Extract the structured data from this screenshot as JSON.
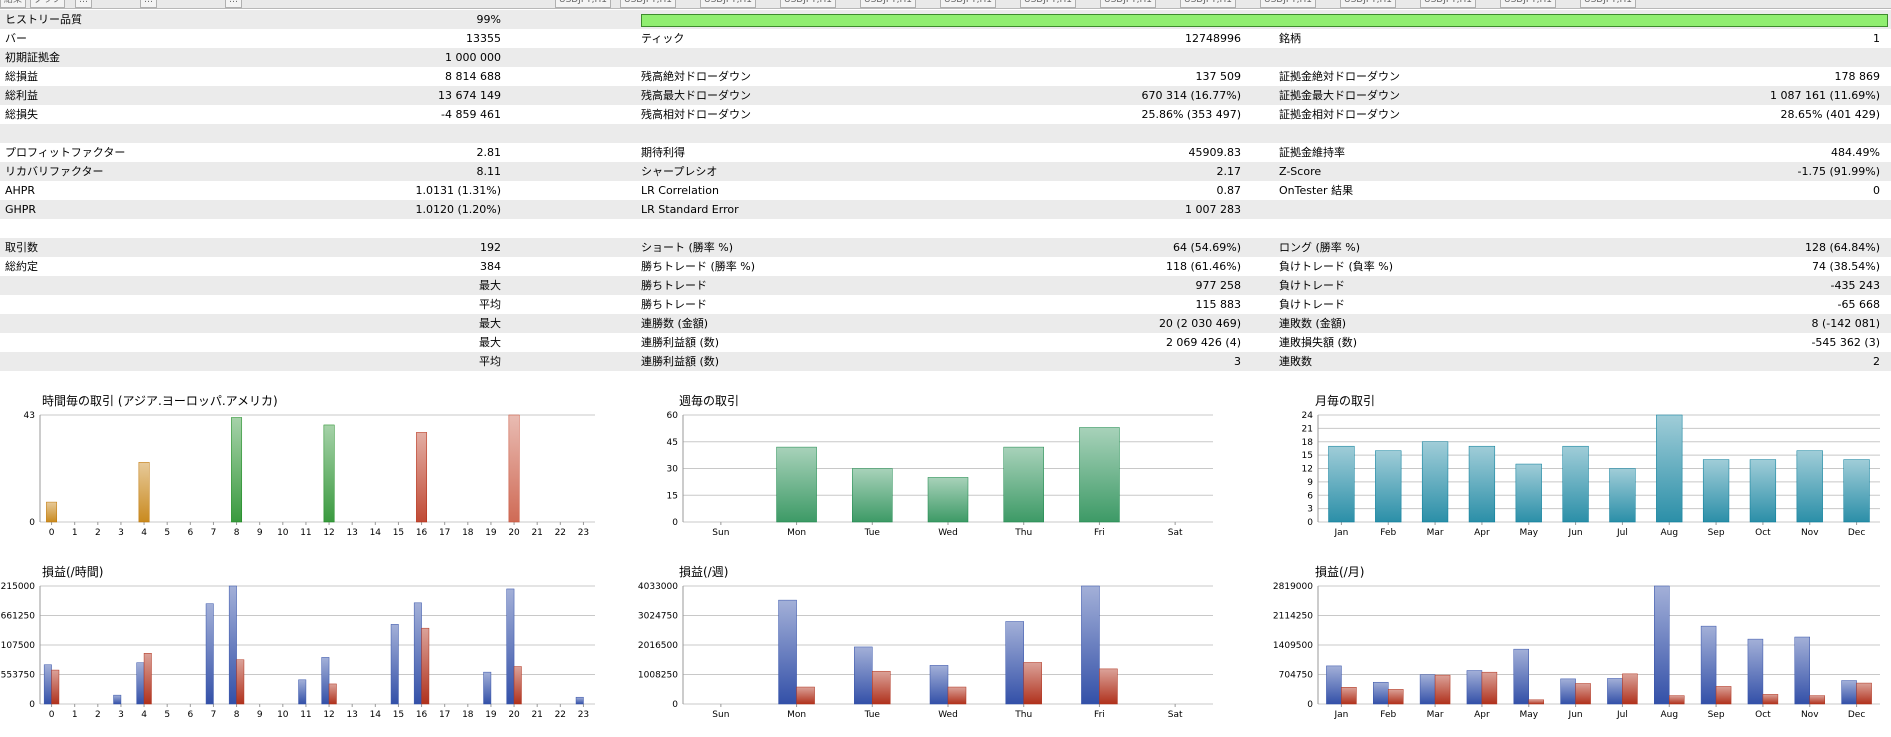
{
  "top_tabs": [
    "結果",
    "グラフ",
    "…",
    "…",
    "…",
    "USDJPY,H1",
    "USDJPY,H1",
    "USDJPY,H1",
    "USDJPY,H1",
    "USDJPY,H1",
    "USDJPY,H1",
    "USDJPY,H1",
    "USDJPY,H1",
    "USDJPY,H1",
    "USDJPY,H1",
    "USDJPY,H1",
    "USDJPY,H1",
    "USDJPY,H1",
    "USDJPY,H1"
  ],
  "stats": {
    "history_quality": {
      "label": "ヒストリー品質",
      "value": "99%",
      "fill_fraction": 0.99
    },
    "rows": [
      {
        "l1": "バー",
        "v1": "13355",
        "l2": "ティック",
        "v2": "12748996",
        "l3": "銘柄",
        "v3": "1"
      },
      {
        "l1": "初期証拠金",
        "v1": "1 000 000",
        "l2": "",
        "v2": "",
        "l3": "",
        "v3": ""
      },
      {
        "l1": "総損益",
        "v1": "8 814 688",
        "l2": "残高絶対ドローダウン",
        "v2": "137 509",
        "l3": "証拠金絶対ドローダウン",
        "v3": "178 869"
      },
      {
        "l1": "総利益",
        "v1": "13 674 149",
        "l2": "残高最大ドローダウン",
        "v2": "670 314 (16.77%)",
        "l3": "証拠金最大ドローダウン",
        "v3": "1 087 161 (11.69%)"
      },
      {
        "l1": "総損失",
        "v1": "-4 859 461",
        "l2": "残高相対ドローダウン",
        "v2": "25.86% (353 497)",
        "l3": "証拠金相対ドローダウン",
        "v3": "28.65% (401 429)"
      },
      {
        "l1": "",
        "v1": "",
        "l2": "",
        "v2": "",
        "l3": "",
        "v3": ""
      },
      {
        "l1": "プロフィットファクター",
        "v1": "2.81",
        "l2": "期待利得",
        "v2": "45909.83",
        "l3": "証拠金維持率",
        "v3": "484.49%"
      },
      {
        "l1": "リカバリファクター",
        "v1": "8.11",
        "l2": "シャープレシオ",
        "v2": "2.17",
        "l3": "Z-Score",
        "v3": "-1.75 (91.99%)"
      },
      {
        "l1": "AHPR",
        "v1": "1.0131 (1.31%)",
        "l2": "LR Correlation",
        "v2": "0.87",
        "l3": "OnTester 結果",
        "v3": "0"
      },
      {
        "l1": "GHPR",
        "v1": "1.0120 (1.20%)",
        "l2": "LR Standard Error",
        "v2": "1 007 283",
        "l3": "",
        "v3": ""
      },
      {
        "l1": "",
        "v1": "",
        "l2": "",
        "v2": "",
        "l3": "",
        "v3": ""
      },
      {
        "l1": "取引数",
        "v1": "192",
        "l2": "ショート (勝率 %)",
        "v2": "64 (54.69%)",
        "l3": "ロング (勝率 %)",
        "v3": "128 (64.84%)"
      },
      {
        "l1": "総約定",
        "v1": "384",
        "l2": "勝ちトレード (勝率 %)",
        "v2": "118 (61.46%)",
        "l3": "負けトレード (負率 %)",
        "v3": "74 (38.54%)"
      },
      {
        "l1": "",
        "v1": "最大",
        "l2": "勝ちトレード",
        "v2": "977 258",
        "l3": "負けトレード",
        "v3": "-435 243"
      },
      {
        "l1": "",
        "v1": "平均",
        "l2": "勝ちトレード",
        "v2": "115 883",
        "l3": "負けトレード",
        "v3": "-65 668"
      },
      {
        "l1": "",
        "v1": "最大",
        "l2": "連勝数 (金額)",
        "v2": "20 (2 030 469)",
        "l3": "連敗数 (金額)",
        "v3": "8 (-142 081)"
      },
      {
        "l1": "",
        "v1": "最大",
        "l2": "連勝利益額 (数)",
        "v2": "2 069 426 (4)",
        "l3": "連敗損失額 (数)",
        "v3": "-545 362 (3)"
      },
      {
        "l1": "",
        "v1": "平均",
        "l2": "連勝利益額 (数)",
        "v2": "3",
        "l3": "連敗数",
        "v3": "2"
      }
    ]
  },
  "chart_data": [
    {
      "id": "hourly-trades",
      "type": "bar",
      "title": "時間毎の取引 (アジア.ヨーロッパ.アメリカ)",
      "categories": [
        "0",
        "1",
        "2",
        "3",
        "4",
        "5",
        "6",
        "7",
        "8",
        "9",
        "10",
        "11",
        "12",
        "13",
        "14",
        "15",
        "16",
        "17",
        "18",
        "19",
        "20",
        "21",
        "22",
        "23"
      ],
      "values": [
        8,
        0,
        0,
        0,
        24,
        0,
        0,
        0,
        42,
        0,
        0,
        0,
        39,
        0,
        0,
        0,
        36,
        0,
        0,
        0,
        43,
        0,
        0,
        0
      ],
      "bar_colors": [
        "#c98a1f",
        "#c98a1f",
        "#c98a1f",
        "#c98a1f",
        "#c98a1f",
        "#c98a1f",
        "#c98a1f",
        "#c98a1f",
        "#3a9a3f",
        "#3a9a3f",
        "#3a9a3f",
        "#3a9a3f",
        "#3a9a3f",
        "#3a9a3f",
        "#3a9a3f",
        "#3a9a3f",
        "#c04a35",
        "#c04a35",
        "#c04a35",
        "#c04a35",
        "#cf6a55",
        "#cf6a55",
        "#cf6a55",
        "#cf6a55"
      ],
      "yticks": [
        "43",
        "0"
      ],
      "ylim": [
        0,
        43
      ],
      "grid": true
    },
    {
      "id": "weekly-trades",
      "type": "bar",
      "title": "週毎の取引",
      "categories": [
        "Sun",
        "Mon",
        "Tue",
        "Wed",
        "Thu",
        "Fri",
        "Sat"
      ],
      "values": [
        0,
        42,
        30,
        25,
        42,
        53,
        0
      ],
      "bar_color": "#3d9a66",
      "yticks": [
        "60",
        "45",
        "30",
        "15",
        "0"
      ],
      "ylim": [
        0,
        60
      ],
      "grid": true
    },
    {
      "id": "monthly-trades",
      "type": "bar",
      "title": "月毎の取引",
      "categories": [
        "Jan",
        "Feb",
        "Mar",
        "Apr",
        "May",
        "Jun",
        "Jul",
        "Aug",
        "Sep",
        "Oct",
        "Nov",
        "Dec"
      ],
      "values": [
        17,
        16,
        18,
        17,
        13,
        17,
        12,
        24,
        14,
        14,
        16,
        14
      ],
      "bar_color": "#2b8fa8",
      "yticks": [
        "24",
        "21",
        "18",
        "15",
        "12",
        "9",
        "6",
        "3",
        "0"
      ],
      "ylim": [
        0,
        24
      ],
      "grid": true
    },
    {
      "id": "hourly-pnl",
      "type": "bar",
      "title": "損益(/時間)",
      "categories": [
        "0",
        "1",
        "2",
        "3",
        "4",
        "5",
        "6",
        "7",
        "8",
        "9",
        "10",
        "11",
        "12",
        "13",
        "14",
        "15",
        "16",
        "17",
        "18",
        "19",
        "20",
        "21",
        "22",
        "23"
      ],
      "series": [
        {
          "values": [
            1330000,
            0,
            0,
            300000,
            1400000,
            0,
            0,
            3400000,
            4000000,
            0,
            0,
            820000,
            1580000,
            0,
            0,
            2700000,
            3430000,
            0,
            0,
            1080000,
            3900000,
            0,
            0,
            230000
          ],
          "color": "#3350a8"
        },
        {
          "values": [
            1150000,
            0,
            0,
            0,
            1720000,
            0,
            0,
            0,
            1500000,
            0,
            0,
            0,
            680000,
            0,
            0,
            0,
            2570000,
            0,
            0,
            0,
            1270000,
            0,
            0,
            0
          ],
          "color": "#b0311c"
        }
      ],
      "yticks": [
        "215000",
        "661250",
        "107500",
        "553750",
        "0"
      ],
      "ylim": [
        0,
        4000000
      ],
      "grid": true
    },
    {
      "id": "weekly-pnl",
      "type": "bar",
      "title": "損益(/週)",
      "categories": [
        "Sun",
        "Mon",
        "Tue",
        "Wed",
        "Thu",
        "Fri",
        "Sat"
      ],
      "series": [
        {
          "values": [
            0,
            3550000,
            1950000,
            1320000,
            2820000,
            4033000,
            0
          ],
          "color": "#3350a8"
        },
        {
          "values": [
            0,
            580000,
            1120000,
            580000,
            1420000,
            1200000,
            0
          ],
          "color": "#b0311c"
        }
      ],
      "yticks": [
        "4033000",
        "3024750",
        "2016500",
        "1008250",
        "0"
      ],
      "ylim": [
        0,
        4033000
      ],
      "grid": true
    },
    {
      "id": "monthly-pnl",
      "type": "bar",
      "title": "損益(/月)",
      "categories": [
        "Jan",
        "Feb",
        "Mar",
        "Apr",
        "May",
        "Jun",
        "Jul",
        "Aug",
        "Sep",
        "Oct",
        "Nov",
        "Dec"
      ],
      "series": [
        {
          "values": [
            910000,
            520000,
            700000,
            800000,
            1310000,
            600000,
            610000,
            2819000,
            1860000,
            1550000,
            1600000,
            560000
          ],
          "color": "#3350a8"
        },
        {
          "values": [
            400000,
            350000,
            690000,
            760000,
            100000,
            490000,
            720000,
            200000,
            420000,
            230000,
            200000,
            500000
          ],
          "color": "#b0311c"
        }
      ],
      "yticks": [
        "2819000",
        "2114250",
        "1409500",
        "704750",
        "0"
      ],
      "ylim": [
        0,
        2819000
      ],
      "grid": true
    }
  ]
}
